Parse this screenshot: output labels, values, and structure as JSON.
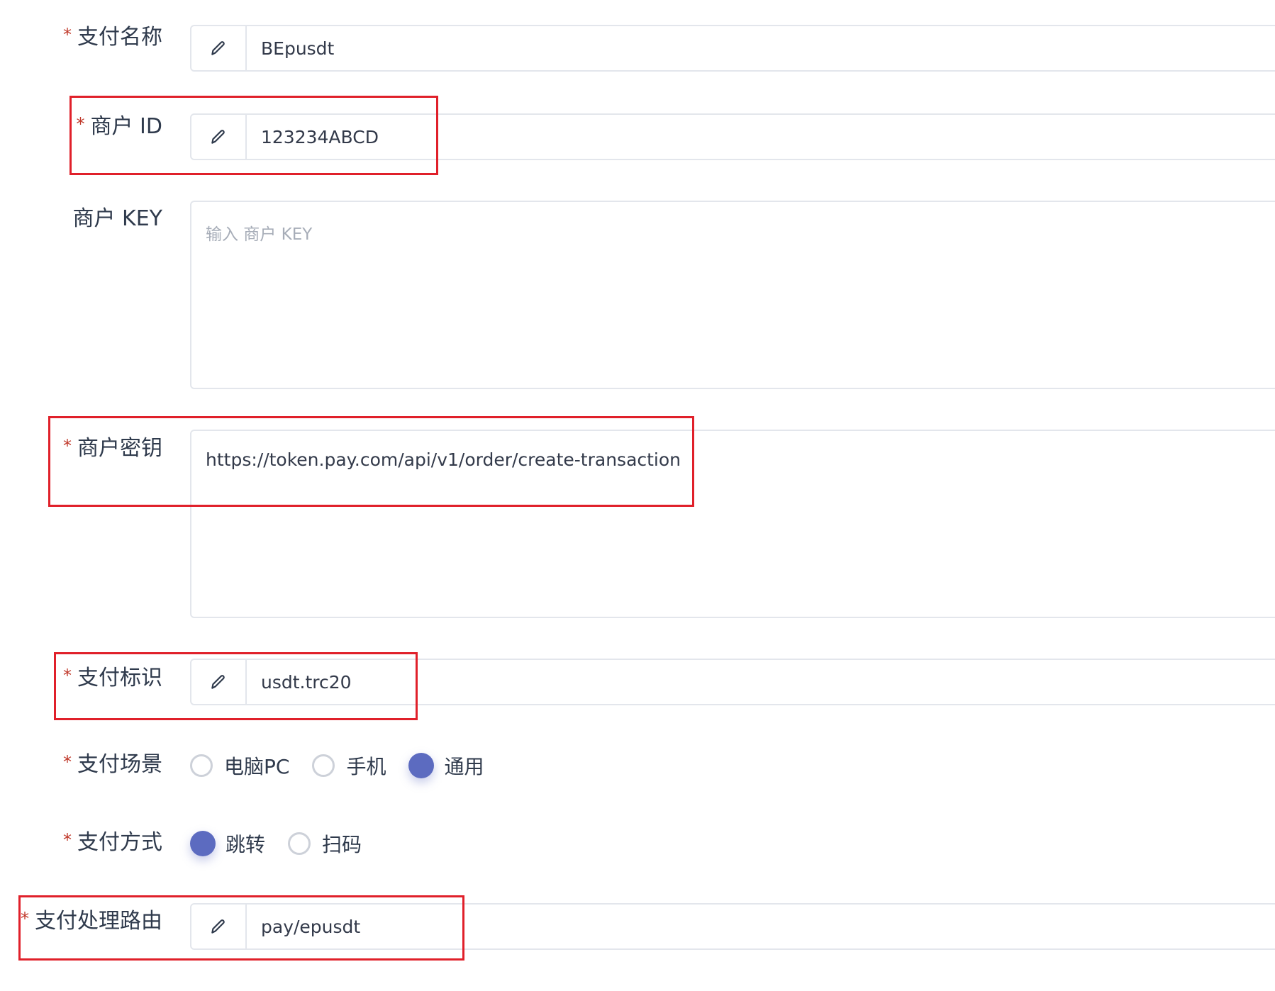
{
  "form": {
    "pay_name": {
      "label": "支付名称",
      "required_mark": "*",
      "value": "BEpusdt"
    },
    "merchant_id": {
      "label": "商户 ID",
      "required_mark": "*",
      "value": "123234ABCD"
    },
    "merchant_key": {
      "label": "商户 KEY",
      "placeholder": "输入 商户 KEY",
      "value": ""
    },
    "merchant_secret": {
      "label": "商户密钥",
      "required_mark": "*",
      "value": "https://token.pay.com/api/v1/order/create-transaction"
    },
    "pay_identifier": {
      "label": "支付标识",
      "required_mark": "*",
      "value": "usdt.trc20"
    },
    "pay_scene": {
      "label": "支付场景",
      "required_mark": "*",
      "options": [
        "电脑PC",
        "手机",
        "通用"
      ],
      "selected": "通用"
    },
    "pay_method": {
      "label": "支付方式",
      "required_mark": "*",
      "options": [
        "跳转",
        "扫码"
      ],
      "selected": "跳转"
    },
    "pay_route": {
      "label": "支付处理路由",
      "required_mark": "*",
      "value": "pay/epusdt"
    }
  },
  "icons": {
    "input_addon": "pencil-edit-icon"
  },
  "colors": {
    "accent": "#5c6bc0",
    "required": "#c0392b",
    "highlight_box": "#e0202a",
    "border": "#e3e6ec",
    "text": "#333a4a",
    "placeholder": "#a7adb8"
  }
}
